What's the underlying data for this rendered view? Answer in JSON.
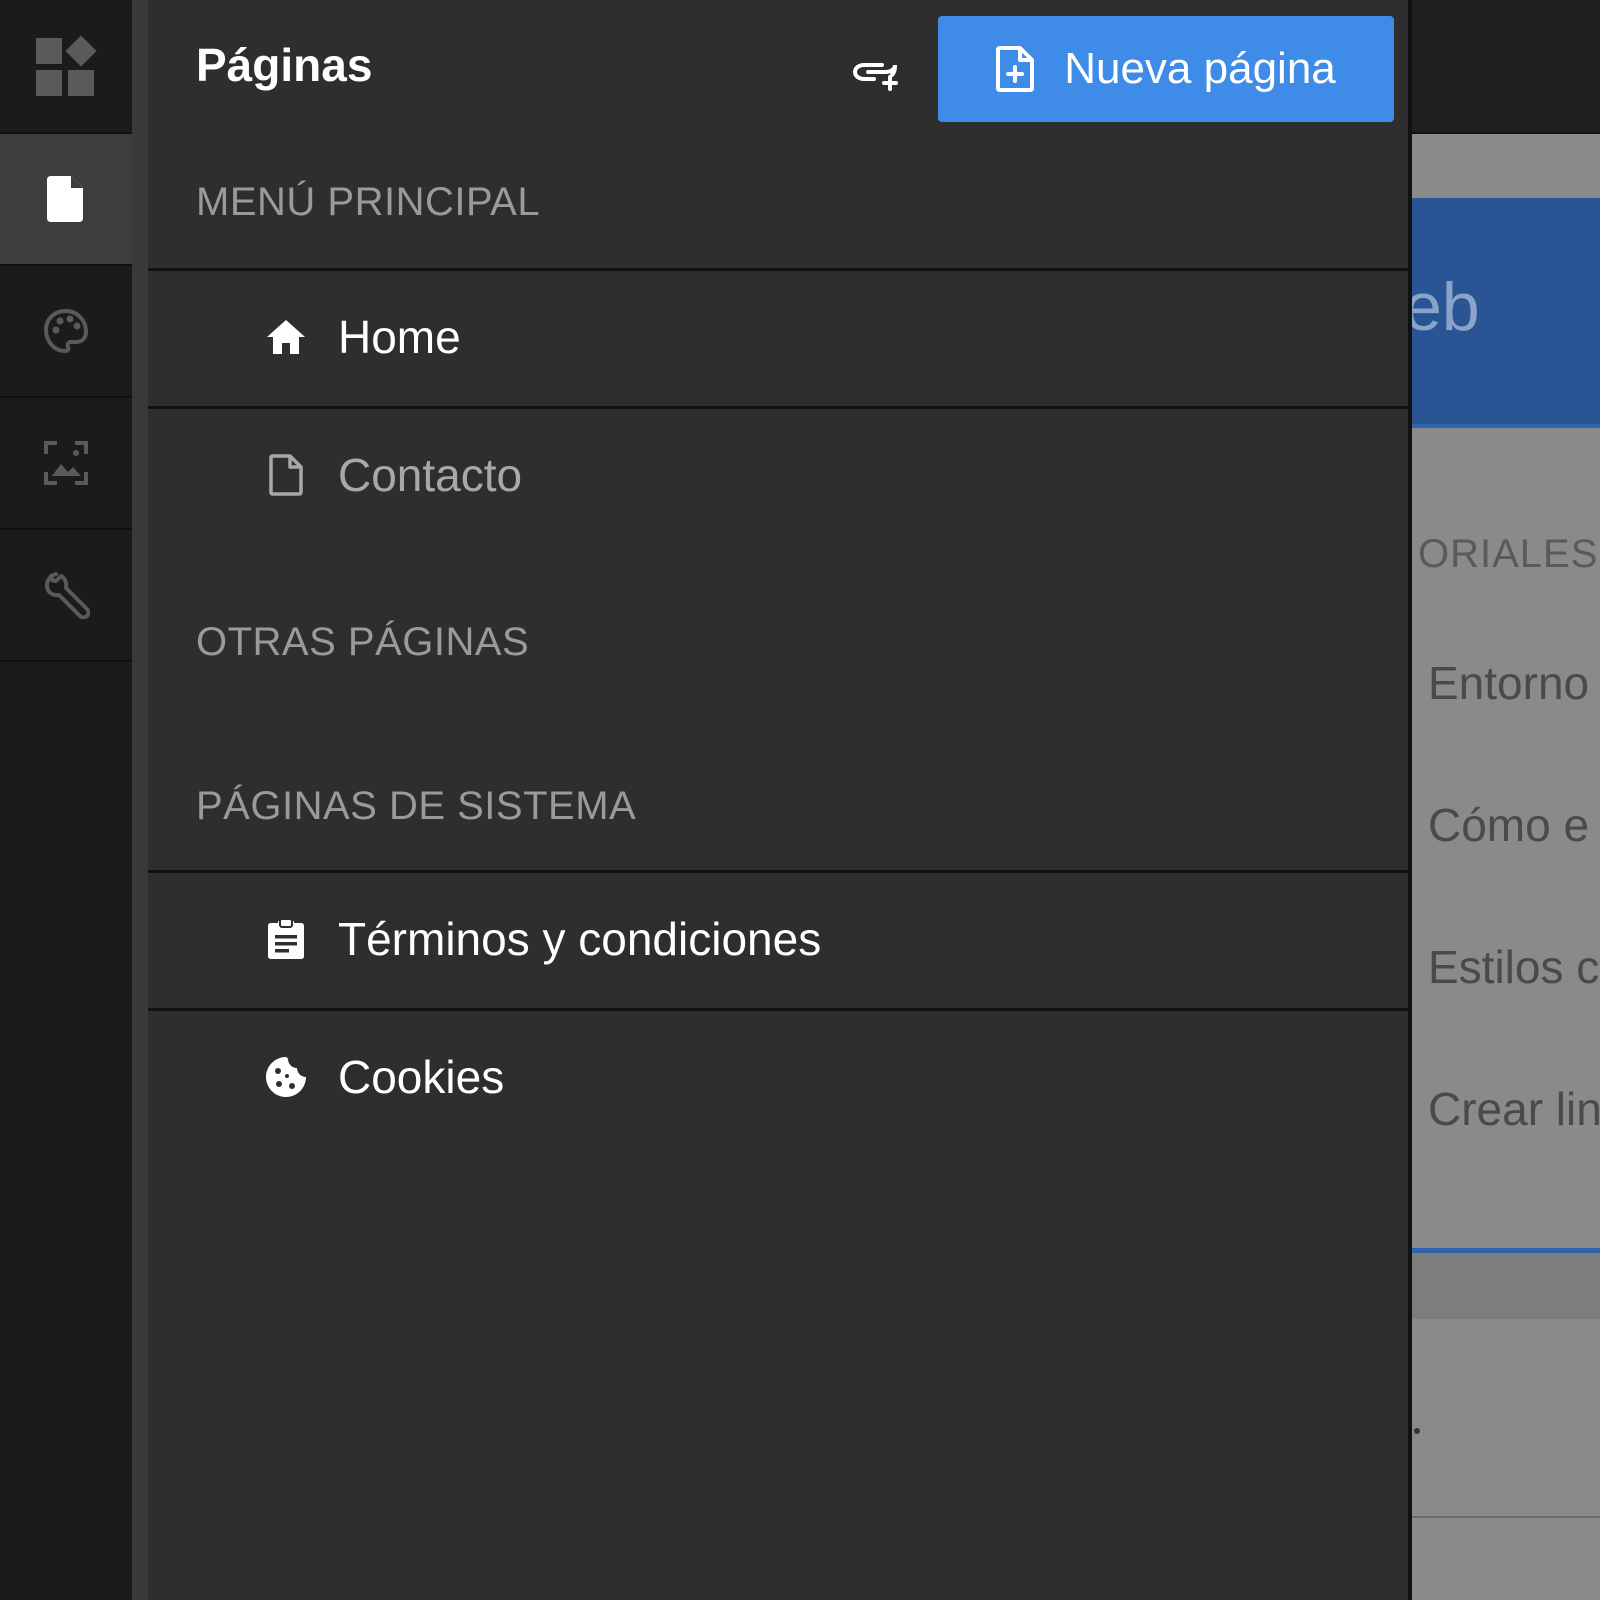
{
  "panel": {
    "title": "Páginas",
    "new_page_label": "Nueva página",
    "sections": {
      "main_menu": {
        "label": "MENÚ PRINCIPAL",
        "items": [
          {
            "label": "Home",
            "icon": "home-icon"
          },
          {
            "label": "Contacto",
            "icon": "page-icon"
          }
        ]
      },
      "other_pages": {
        "label": "OTRAS PÁGINAS",
        "items": []
      },
      "system_pages": {
        "label": "PÁGINAS DE SISTEMA",
        "items": [
          {
            "label": "Términos y condiciones",
            "icon": "clipboard-icon"
          },
          {
            "label": "Cookies",
            "icon": "cookie-icon"
          }
        ]
      }
    }
  },
  "rail": {
    "items": [
      "logo-icon",
      "page-icon",
      "palette-icon",
      "image-icon",
      "wrench-icon"
    ]
  },
  "preview": {
    "hero_fragment": "eb",
    "section_fragment": "ORIALES",
    "links": [
      "Entorno",
      "Cómo e",
      "Estilos c",
      "Crear lin"
    ]
  },
  "colors": {
    "accent": "#3f8be8",
    "panel_bg": "#2e2e2e",
    "rail_bg": "#1b1b1b",
    "muted_text": "#9a9a9a"
  }
}
